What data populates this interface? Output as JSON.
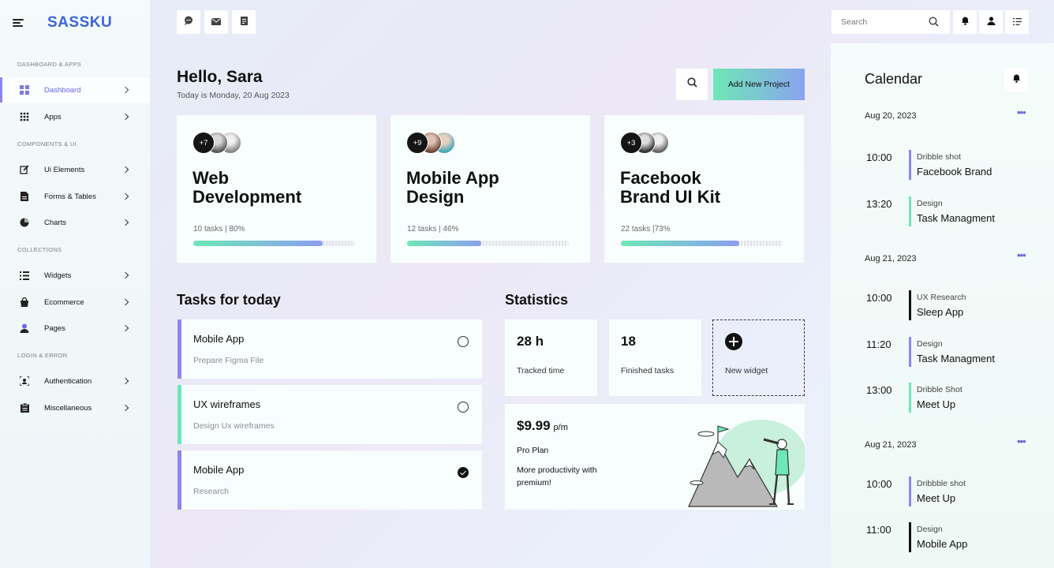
{
  "brand": {
    "name": "SASSKU"
  },
  "sidebar": {
    "sections": [
      "DASHBOARD & APPS",
      "COMPONENTS & UI",
      "COLLECTIONS",
      "LOGIN & ERROR"
    ],
    "items": [
      {
        "label": "Dashboard",
        "icon": "grid-icon"
      },
      {
        "label": "Apps",
        "icon": "apps-dots-icon"
      },
      {
        "label": "Ui Elements",
        "icon": "edit-icon"
      },
      {
        "label": "Forms & Tables",
        "icon": "document-icon"
      },
      {
        "label": "Charts",
        "icon": "pie-chart-icon"
      },
      {
        "label": "Widgets",
        "icon": "list-icon"
      },
      {
        "label": "Ecommerce",
        "icon": "bag-icon"
      },
      {
        "label": "Pages",
        "icon": "user-icon"
      },
      {
        "label": "Authentication",
        "icon": "face-scan-icon"
      },
      {
        "label": "Miscellaneous",
        "icon": "clipboard-icon"
      }
    ]
  },
  "topbar": {
    "icons": [
      "chat-icon",
      "mail-icon",
      "notes-icon"
    ]
  },
  "header": {
    "greeting": "Hello, Sara",
    "date": "Today is Monday, 20 Aug 2023",
    "add_button": "Add New Project"
  },
  "projects": [
    {
      "title_line1": "Web",
      "title_line2": "Development",
      "extra": "+7",
      "meta": "10 tasks | 80%",
      "progress": 0.8
    },
    {
      "title_line1": "Mobile App",
      "title_line2": "Design",
      "extra": "+9",
      "meta": "12 tasks | 46%",
      "progress": 0.46
    },
    {
      "title_line1": "Facebook",
      "title_line2": "Brand UI Kit",
      "extra": "+3",
      "meta": "22 tasks |73%",
      "progress": 0.73
    }
  ],
  "tasks": {
    "title": "Tasks for today",
    "items": [
      {
        "title": "Mobile App",
        "subtitle": "Prepare Figma File",
        "done": false,
        "accent": "#8b86ee"
      },
      {
        "title": "UX wireframes",
        "subtitle": "Design Ux wireframes",
        "done": false,
        "accent": "#6ee7b7"
      },
      {
        "title": "Mobile App",
        "subtitle": "Research",
        "done": true,
        "accent": "#8b86ee"
      }
    ]
  },
  "statistics": {
    "title": "Statistics",
    "cards": [
      {
        "value": "28 h",
        "label": "Tracked time"
      },
      {
        "value": "18",
        "label": "Finished tasks"
      }
    ],
    "new_widget": "New widget"
  },
  "promo": {
    "price": "$9.99",
    "period": "p/m",
    "plan": "Pro Plan",
    "desc": "More productivity with premium!"
  },
  "right": {
    "search_placeholder": "Search",
    "icons": [
      "search-icon",
      "bell-icon",
      "user-icon",
      "list-icon"
    ]
  },
  "calendar": {
    "title": "Calendar",
    "days": [
      {
        "date": "Aug 20, 2023",
        "events": [
          {
            "time": "10:00",
            "type": "Dribble shot",
            "name": "Facebook Brand",
            "color": "#8b86ee"
          },
          {
            "time": "13:20",
            "type": "Design",
            "name": "Task Managment",
            "color": "#6ee7b7"
          }
        ]
      },
      {
        "date": "Aug 21, 2023",
        "events": [
          {
            "time": "10:00",
            "type": "UX Research",
            "name": "Sleep App",
            "color": "#111111"
          },
          {
            "time": "11:20",
            "type": "Design",
            "name": "Task Managment",
            "color": "#8b86ee"
          },
          {
            "time": "13:00",
            "type": "Dribble  Shot",
            "name": "Meet Up",
            "color": "#6ee7b7"
          }
        ]
      },
      {
        "date": "Aug 21, 2023",
        "events": [
          {
            "time": "10:00",
            "type": "Dribbble shot",
            "name": "Meet Up",
            "color": "#8b86ee"
          },
          {
            "time": "11:00",
            "type": "Design",
            "name": "Mobile App",
            "color": "#111111"
          }
        ]
      }
    ]
  }
}
